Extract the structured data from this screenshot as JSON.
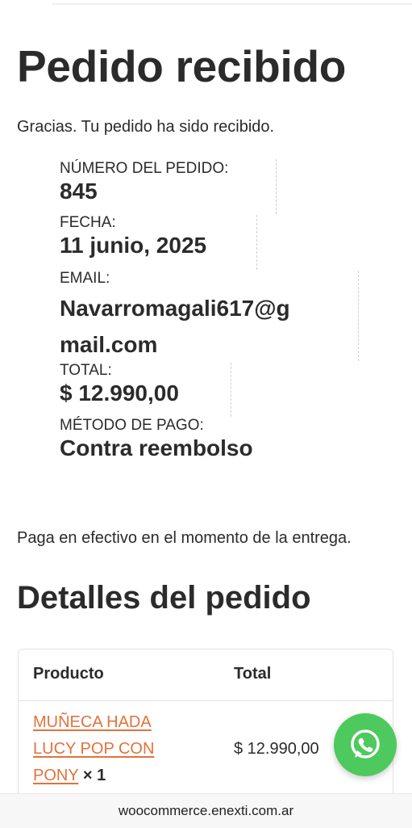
{
  "page": {
    "title": "Pedido recibido",
    "thanks": "Gracias. Tu pedido ha sido recibido."
  },
  "overview": {
    "order_number_label": "NÚMERO DEL PEDIDO:",
    "order_number": "845",
    "date_label": "FECHA:",
    "date": "11 junio, 2025",
    "email_label": "EMAIL:",
    "email_line1": "Navarromagali617@g",
    "email_line2": "mail.com",
    "total_label": "TOTAL:",
    "total": "$ 12.990,00",
    "payment_label": "MÉTODO DE PAGO:",
    "payment": "Contra reembolso"
  },
  "payment_note": "Paga en efectivo en el momento de la entrega.",
  "details": {
    "title": "Detalles del pedido",
    "columns": [
      "Producto",
      "Total"
    ],
    "rows": [
      {
        "product_line1": "MUÑECA HADA",
        "product_line2": "LUCY POP CON",
        "product_line3": "PONY",
        "quantity": "× 1",
        "total": "$ 12.990,00"
      }
    ]
  },
  "footer": {
    "url": "woocommerce.enexti.com.ar"
  },
  "colors": {
    "accent_link": "#e2723b",
    "whatsapp_green": "#4dc95d"
  }
}
